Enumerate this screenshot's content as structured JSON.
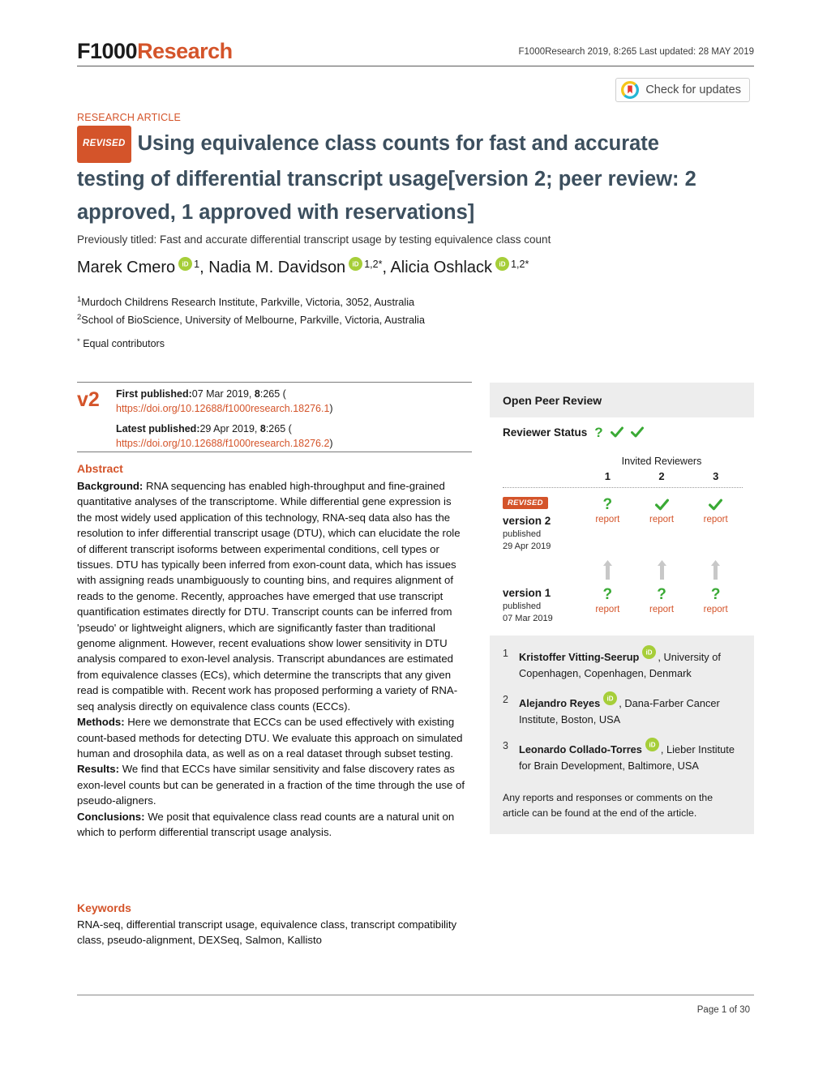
{
  "header": {
    "logo_primary": "F1000",
    "logo_secondary": "Research",
    "running_head": "F1000Research 2019, 8:265 Last updated: 28 MAY 2019",
    "crossmark_label": "Check for updates"
  },
  "article": {
    "type": "RESEARCH ARTICLE",
    "revised_badge": "REVISED",
    "title": "Using equivalence class counts for fast and accurate testing of differential transcript usage",
    "title_version_suffix": "[version 2; peer review: 2 approved, 1 approved with reservations]",
    "previous_title": "Previously titled: Fast and accurate differential transcript usage by testing equivalence class count",
    "authors": [
      {
        "name": "Marek Cmero",
        "sup": "1"
      },
      {
        "name": "Nadia M. Davidson",
        "sup": "1,2*"
      },
      {
        "name": "Alicia Oshlack",
        "sup": "1,2*"
      }
    ],
    "affiliations": [
      {
        "sup": "1",
        "text": "Murdoch Childrens Research Institute, Parkville, Victoria, 3052, Australia"
      },
      {
        "sup": "2",
        "text": "School of BioScience, University of Melbourne, Parkville, Victoria, Australia"
      }
    ],
    "equal_contributors_sup": "*",
    "equal_contributors": "Equal contributors"
  },
  "version_block": {
    "version_tag": "v2",
    "first_published_label": "First published:",
    "first_published_value": "07 Mar 2019, ",
    "first_published_volume": "8",
    "first_published_issue": ":265 (",
    "first_doi": "https://doi.org/10.12688/f1000research.18276.1",
    "close_paren": ")",
    "latest_published_label": "Latest published:",
    "latest_published_value": "29 Apr 2019, ",
    "latest_published_volume": "8",
    "latest_published_issue": ":265 (",
    "latest_doi": "https://doi.org/10.12688/f1000research.18276.2"
  },
  "abstract": {
    "heading": "Abstract",
    "background_label": "Background:",
    "background_text": " RNA sequencing has enabled high-throughput and fine-grained quantitative analyses of the transcriptome. While differential gene expression is the most widely used application of this technology, RNA-seq data also has the resolution to infer differential transcript usage (DTU), which can elucidate the role of different transcript isoforms between experimental conditions, cell types or tissues. DTU has typically been inferred from exon-count data, which has issues with assigning reads unambiguously to counting bins, and requires alignment of reads to the genome. Recently, approaches have emerged that use transcript quantification estimates directly for DTU. Transcript counts can be inferred from 'pseudo' or lightweight aligners, which are significantly faster than traditional genome alignment. However, recent evaluations show lower sensitivity in DTU analysis compared to exon-level analysis. Transcript abundances are estimated from equivalence classes (ECs), which determine the transcripts that any given read is compatible with. Recent work has proposed performing a variety of RNA-seq analysis directly on equivalence class counts (ECCs).",
    "methods_label": "Methods:",
    "methods_text": " Here we demonstrate that ECCs can be used effectively with existing count-based methods for detecting DTU. We evaluate this approach on simulated human and drosophila data, as well as on a real dataset through subset testing.",
    "results_label": "Results:",
    "results_text": " We find that ECCs have similar sensitivity and false discovery rates as exon-level counts but can be generated in a fraction of the time through the use of pseudo-aligners.",
    "conclusions_label": "Conclusions:",
    "conclusions_text": " We posit that equivalence class read counts are a natural unit on which to perform differential transcript usage analysis."
  },
  "keywords": {
    "heading": "Keywords",
    "text": "RNA-seq, differential transcript usage, equivalence class, transcript compatibility class, pseudo-alignment, DEXSeq, Salmon, Kallisto"
  },
  "peer_review": {
    "panel_title": "Open Peer Review",
    "status_label": "Reviewer Status",
    "status_marks": [
      "?",
      "check",
      "check"
    ],
    "invited_reviewers_label": "Invited Reviewers",
    "reviewer_numbers": [
      "1",
      "2",
      "3"
    ],
    "versions": [
      {
        "badge": "REVISED",
        "name": "version 2",
        "published_label": "published",
        "published_date": "29 Apr 2019",
        "marks": [
          "?",
          "check",
          "check"
        ],
        "reports": [
          "report",
          "report",
          "report"
        ]
      },
      {
        "badge": "",
        "name": "version 1",
        "published_label": "published",
        "published_date": "07 Mar 2019",
        "marks": [
          "?",
          "?",
          "?"
        ],
        "reports": [
          "report",
          "report",
          "report"
        ]
      }
    ],
    "reviewers": [
      {
        "index": "1",
        "name": "Kristoffer Vitting-Seerup",
        "affiliation": ", University of Copenhagen, Copenhagen, Denmark"
      },
      {
        "index": "2",
        "name": "Alejandro Reyes",
        "affiliation": ", Dana-Farber Cancer Institute, Boston, USA"
      },
      {
        "index": "3",
        "name": "Leonardo Collado-Torres",
        "affiliation": ", Lieber Institute for Brain Development, Baltimore, USA"
      }
    ],
    "footnote": "Any reports and responses or comments on the article can be found at the end of the article."
  },
  "footer": {
    "page_number": "Page 1 of 30"
  },
  "colors": {
    "brand_orange": "#d4542a",
    "title_slate": "#3c4f5e",
    "approved_green": "#3aaa35",
    "panel_grey": "#ededed"
  }
}
